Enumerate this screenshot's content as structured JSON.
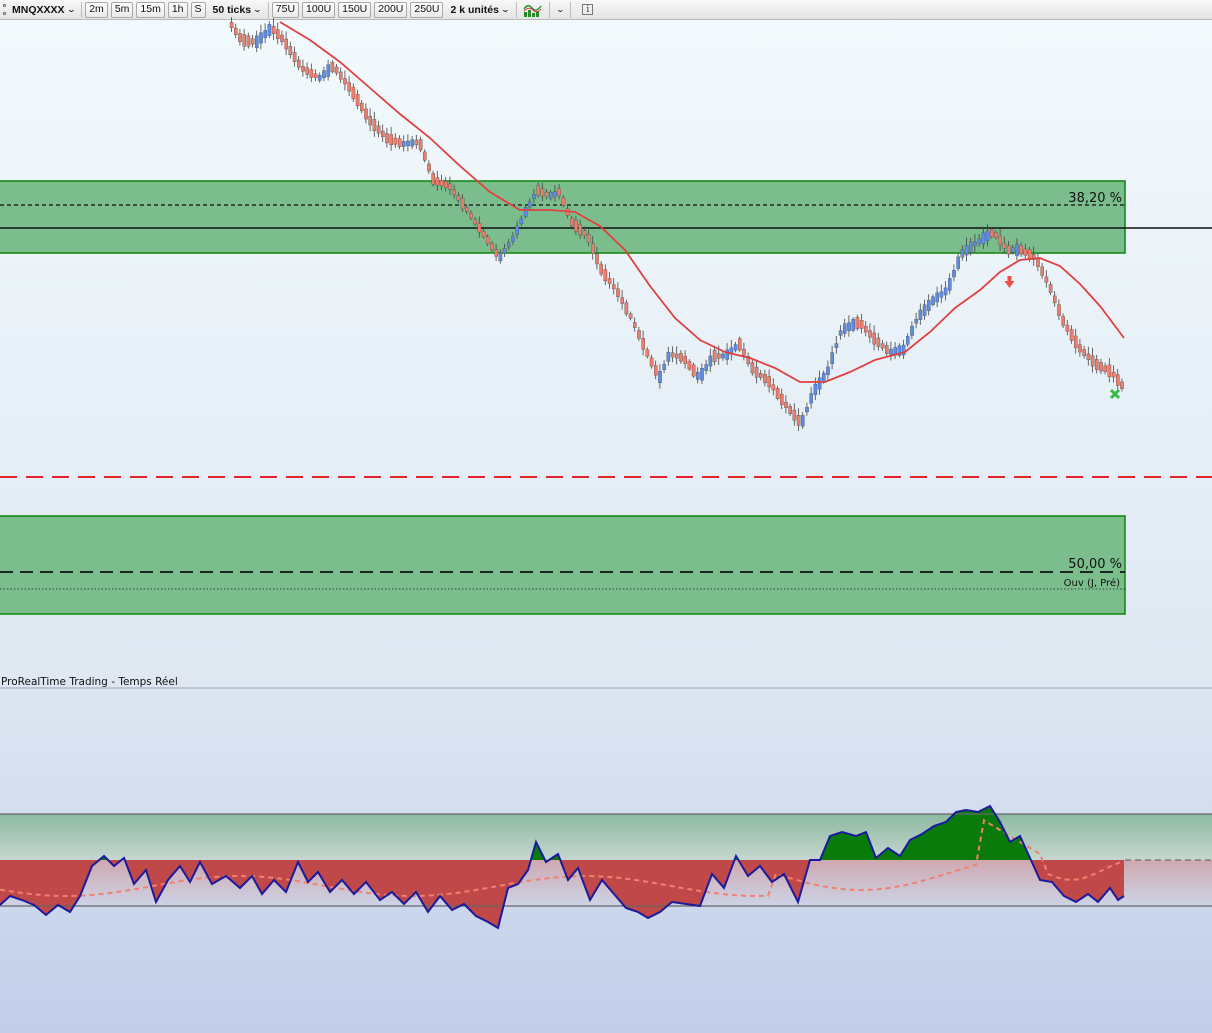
{
  "toolbar": {
    "ticker": "MNQXXXX",
    "timeframes": [
      "2m",
      "5m",
      "15m",
      "1h",
      "S"
    ],
    "ticks_label": "50 ticks",
    "units": [
      "75U",
      "100U",
      "150U",
      "200U",
      "250U"
    ],
    "range_label": "2 k unités",
    "info_label": "i"
  },
  "colors": {
    "up_candle": "#5b8de8",
    "down_candle": "#f07c6c",
    "moving_average": "#e04040",
    "zone_fill": "#7bbd8c",
    "zone_border": "#178a17",
    "oscillator_line": "#1a1a9c",
    "oscillator_positive": "#0a7a0a",
    "oscillator_negative": "#c04848"
  },
  "price_panel": {
    "fib_upper_label": "38,20 %",
    "fib_lower_label": "50,00 %",
    "open_label": "Ouv (J, Pré)",
    "markers": {
      "down_arrow": "sell-arrow-icon",
      "cross": "cross-icon"
    }
  },
  "indicator_panel": {
    "title": "ProRealTime Trading - Temps Réel"
  }
}
